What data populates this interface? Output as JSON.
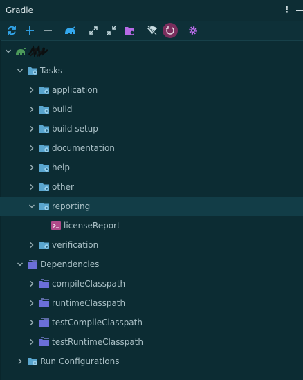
{
  "panel": {
    "title": "Gradle"
  },
  "toolbar": {
    "buttons": [
      {
        "name": "reload-all-projects-icon"
      },
      {
        "name": "link-project-icon"
      },
      {
        "name": "unlink-project-icon"
      },
      {
        "name": "execute-task-icon"
      },
      {
        "name": "expand-all-icon"
      },
      {
        "name": "collapse-all-icon"
      },
      {
        "name": "open-project-folder-icon"
      },
      {
        "name": "toggle-offline-mode-icon"
      },
      {
        "name": "build-and-run-settings-icon"
      },
      {
        "name": "gradle-settings-icon"
      }
    ]
  },
  "tree": {
    "root_label": "",
    "tasks_label": "Tasks",
    "task_groups": [
      "application",
      "build",
      "build setup",
      "documentation",
      "help",
      "other",
      "reporting",
      "verification"
    ],
    "reporting_child": "licenseReport",
    "dependencies_label": "Dependencies",
    "dependency_groups": [
      "compileClasspath",
      "runtimeClasspath",
      "testCompileClasspath",
      "testRuntimeClasspath"
    ],
    "run_configurations_label": "Run Configurations"
  },
  "colors": {
    "background": "#0c2c33",
    "selected_row": "#123d47",
    "folder_blue": "#5aa6cf",
    "gear_purple": "#c06ff0",
    "green_elephant": "#4c9a5a",
    "task_icon": "#b04a8a"
  }
}
